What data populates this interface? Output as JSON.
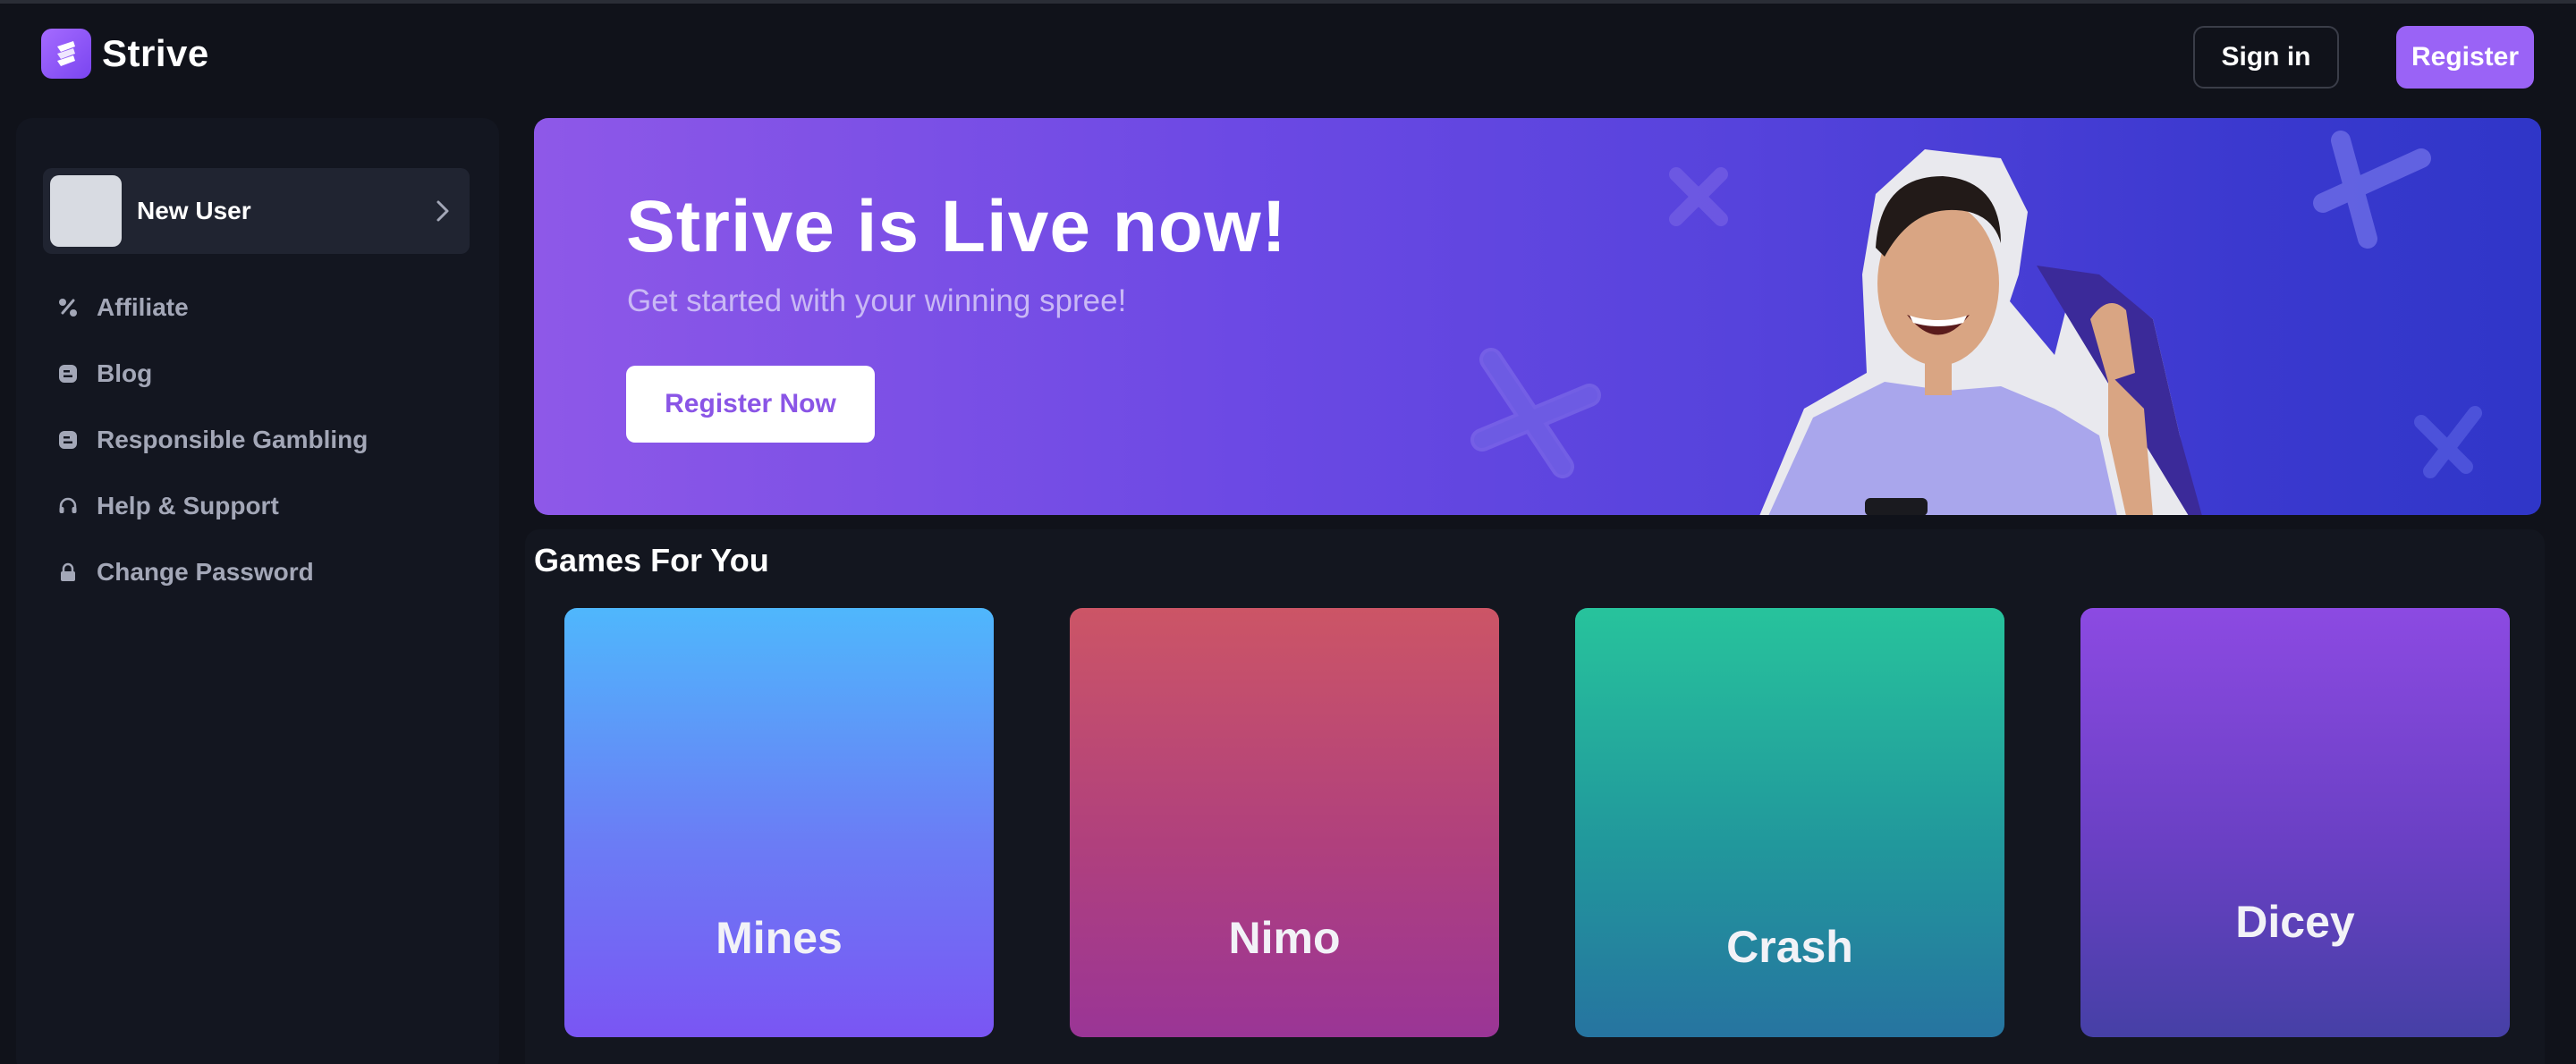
{
  "header": {
    "brand": "Strive",
    "sign_in_label": "Sign in",
    "register_label": "Register"
  },
  "sidebar": {
    "user_name": "New User",
    "items": [
      {
        "label": "Affiliate",
        "icon": "affiliate-icon"
      },
      {
        "label": "Blog",
        "icon": "blog-icon"
      },
      {
        "label": "Responsible Gambling",
        "icon": "responsible-gambling-icon"
      },
      {
        "label": "Help & Support",
        "icon": "headset-icon"
      },
      {
        "label": "Change Password",
        "icon": "lock-icon"
      }
    ]
  },
  "banner": {
    "title": "Strive is Live now!",
    "subtitle": "Get started with your winning spree!",
    "cta_label": "Register Now"
  },
  "games": {
    "title": "Games For You",
    "cards": [
      {
        "name": "Mines"
      },
      {
        "name": "Nimo"
      },
      {
        "name": "Crash"
      },
      {
        "name": "Dicey"
      }
    ]
  },
  "colors": {
    "background": "#10121a",
    "accent": "#9a63f6",
    "sidebar_bg": "#131620"
  }
}
